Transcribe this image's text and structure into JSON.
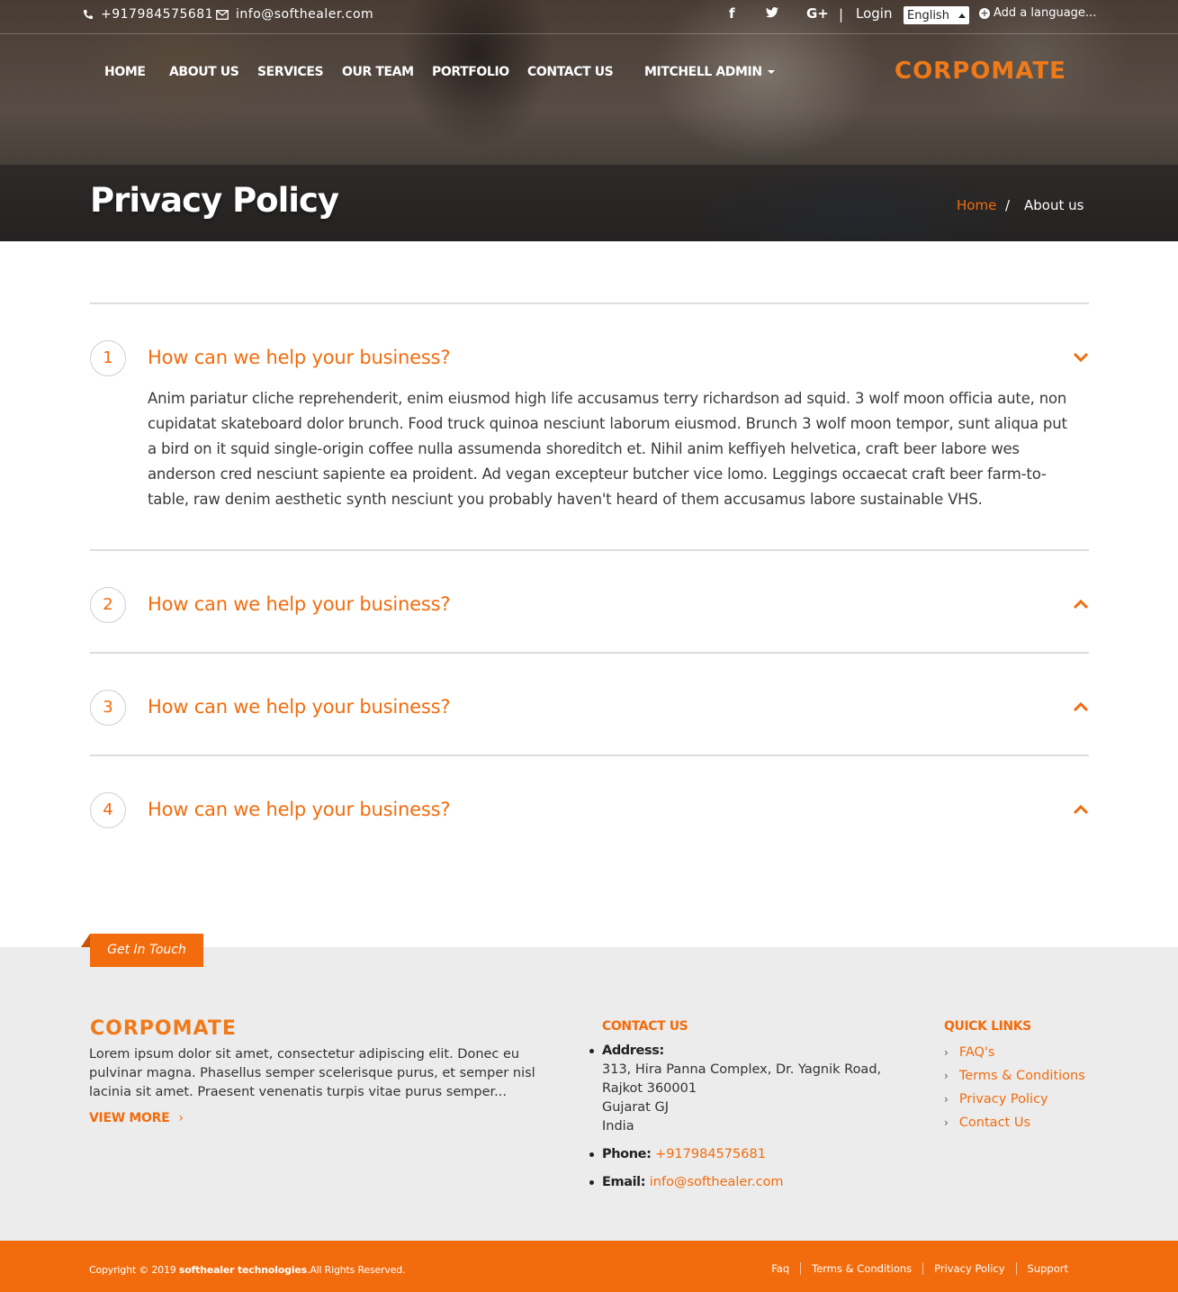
{
  "topbar": {
    "phone": "+917984575681",
    "email": "info@softhealer.com",
    "social": [
      {
        "icon": "facebook-icon",
        "glyph": "f"
      },
      {
        "icon": "twitter-icon",
        "glyph": "t"
      },
      {
        "icon": "google-plus-icon",
        "glyph": "G+"
      }
    ],
    "separator": "|",
    "login": "Login",
    "language": "English",
    "add_language": "Add a language..."
  },
  "nav": {
    "items": [
      "HOME",
      "ABOUT US",
      "SERVICES",
      "OUR TEAM",
      "PORTFOLIO",
      "CONTACT US",
      "MITCHELL ADMIN"
    ]
  },
  "brand": {
    "logo": "CORPOMATE"
  },
  "banner": {
    "title": "Privacy Policy",
    "breadcrumb": {
      "home": "Home",
      "separator": "/",
      "current": "About us"
    }
  },
  "accordion": [
    {
      "num": "1",
      "question": "How can we help your business?",
      "expanded": true,
      "answer": "Anim pariatur cliche reprehenderit, enim eiusmod high life accusamus terry richardson ad squid. 3 wolf moon officia aute, non cupidatat skateboard dolor brunch. Food truck quinoa nesciunt laborum eiusmod. Brunch 3 wolf moon tempor, sunt aliqua put a bird on it squid single-origin coffee nulla assumenda shoreditch et. Nihil anim keffiyeh helvetica, craft beer labore wes anderson cred nesciunt sapiente ea proident. Ad vegan excepteur butcher vice lomo. Leggings occaecat craft beer farm-to-table, raw denim aesthetic synth nesciunt you probably haven't heard of them accusamus labore sustainable VHS."
    },
    {
      "num": "2",
      "question": "How can we help your business?",
      "expanded": false
    },
    {
      "num": "3",
      "question": "How can we help your business?",
      "expanded": false
    },
    {
      "num": "4",
      "question": "How can we help your business?",
      "expanded": false
    }
  ],
  "footer": {
    "get_in_touch": "Get In Touch",
    "logo": "CORPOMATE",
    "about": "Lorem ipsum dolor sit amet, consectetur adipiscing elit. Donec eu pulvinar magna. Phasellus semper scelerisque purus, et semper nisl lacinia sit amet. Praesent venenatis turpis vitae purus semper...",
    "view_more": "VIEW MORE",
    "contact_heading": "CONTACT US",
    "address_label": "Address:",
    "address_lines": [
      "313, Hira Panna Complex, Dr. Yagnik Road,",
      "Rajkot 360001",
      "Gujarat GJ",
      "India"
    ],
    "phone_label": "Phone:",
    "phone": "+917984575681",
    "email_label": "Email:",
    "email": "info@softhealer.com",
    "quick_links_heading": "QUICK LINKS",
    "quick_links": [
      "FAQ's",
      "Terms & Conditions",
      "Privacy Policy",
      "Contact Us"
    ]
  },
  "bottombar": {
    "copyright_prefix": "Copyright © 2019",
    "company": "softhealer technologies",
    "copyright_suffix": ".All Rights Reserved.",
    "links": [
      "Faq",
      "Terms & Conditions",
      "Privacy Policy",
      "Support"
    ]
  },
  "colors": {
    "accent": "#f26c0d",
    "footer_bg": "#ececec"
  }
}
